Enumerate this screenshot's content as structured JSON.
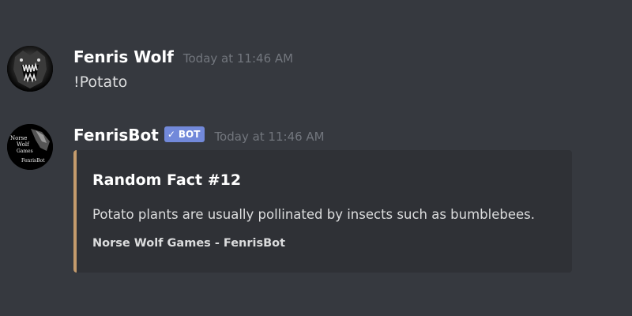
{
  "messages": [
    {
      "username": "Fenris Wolf",
      "timestamp": "Today at 11:46 AM",
      "content": "!Potato",
      "avatar_icon": "wolf-snarl-avatar"
    },
    {
      "username": "FenrisBot",
      "bot_tag": "BOT",
      "bot_check": "✓",
      "timestamp": "Today at 11:46 AM",
      "avatar_icon": "norse-wolf-games-logo",
      "avatar_text": [
        "Norse",
        "Wolf",
        "Games",
        "FenrisBot"
      ],
      "embed": {
        "title": "Random Fact #12",
        "description": "Potato plants are usually pollinated by insects such as bumblebees.",
        "footer": "Norse Wolf Games - FenrisBot",
        "accent_color": "#c49b6c"
      }
    }
  ],
  "colors": {
    "background": "#36393f",
    "embed_background": "#2f3136",
    "bot_tag": "#7289da",
    "timestamp": "#72767d"
  }
}
